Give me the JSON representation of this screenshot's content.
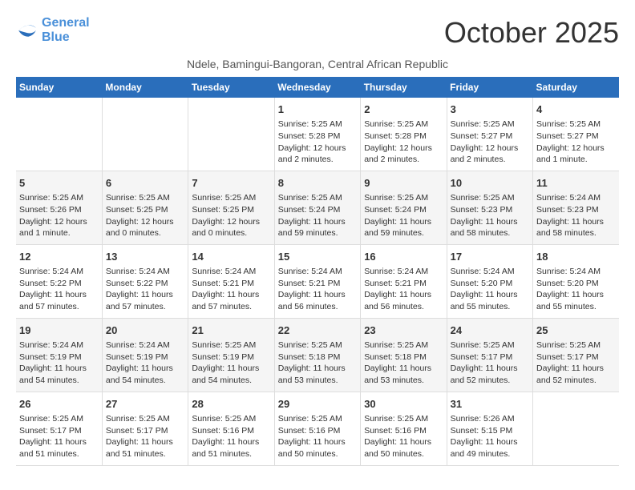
{
  "logo": {
    "line1": "General",
    "line2": "Blue"
  },
  "title": "October 2025",
  "subtitle": "Ndele, Bamingui-Bangoran, Central African Republic",
  "weekdays": [
    "Sunday",
    "Monday",
    "Tuesday",
    "Wednesday",
    "Thursday",
    "Friday",
    "Saturday"
  ],
  "weeks": [
    [
      {
        "day": "",
        "info": ""
      },
      {
        "day": "",
        "info": ""
      },
      {
        "day": "",
        "info": ""
      },
      {
        "day": "1",
        "info": "Sunrise: 5:25 AM\nSunset: 5:28 PM\nDaylight: 12 hours\nand 2 minutes."
      },
      {
        "day": "2",
        "info": "Sunrise: 5:25 AM\nSunset: 5:28 PM\nDaylight: 12 hours\nand 2 minutes."
      },
      {
        "day": "3",
        "info": "Sunrise: 5:25 AM\nSunset: 5:27 PM\nDaylight: 12 hours\nand 2 minutes."
      },
      {
        "day": "4",
        "info": "Sunrise: 5:25 AM\nSunset: 5:27 PM\nDaylight: 12 hours\nand 1 minute."
      }
    ],
    [
      {
        "day": "5",
        "info": "Sunrise: 5:25 AM\nSunset: 5:26 PM\nDaylight: 12 hours\nand 1 minute."
      },
      {
        "day": "6",
        "info": "Sunrise: 5:25 AM\nSunset: 5:25 PM\nDaylight: 12 hours\nand 0 minutes."
      },
      {
        "day": "7",
        "info": "Sunrise: 5:25 AM\nSunset: 5:25 PM\nDaylight: 12 hours\nand 0 minutes."
      },
      {
        "day": "8",
        "info": "Sunrise: 5:25 AM\nSunset: 5:24 PM\nDaylight: 11 hours\nand 59 minutes."
      },
      {
        "day": "9",
        "info": "Sunrise: 5:25 AM\nSunset: 5:24 PM\nDaylight: 11 hours\nand 59 minutes."
      },
      {
        "day": "10",
        "info": "Sunrise: 5:25 AM\nSunset: 5:23 PM\nDaylight: 11 hours\nand 58 minutes."
      },
      {
        "day": "11",
        "info": "Sunrise: 5:24 AM\nSunset: 5:23 PM\nDaylight: 11 hours\nand 58 minutes."
      }
    ],
    [
      {
        "day": "12",
        "info": "Sunrise: 5:24 AM\nSunset: 5:22 PM\nDaylight: 11 hours\nand 57 minutes."
      },
      {
        "day": "13",
        "info": "Sunrise: 5:24 AM\nSunset: 5:22 PM\nDaylight: 11 hours\nand 57 minutes."
      },
      {
        "day": "14",
        "info": "Sunrise: 5:24 AM\nSunset: 5:21 PM\nDaylight: 11 hours\nand 57 minutes."
      },
      {
        "day": "15",
        "info": "Sunrise: 5:24 AM\nSunset: 5:21 PM\nDaylight: 11 hours\nand 56 minutes."
      },
      {
        "day": "16",
        "info": "Sunrise: 5:24 AM\nSunset: 5:21 PM\nDaylight: 11 hours\nand 56 minutes."
      },
      {
        "day": "17",
        "info": "Sunrise: 5:24 AM\nSunset: 5:20 PM\nDaylight: 11 hours\nand 55 minutes."
      },
      {
        "day": "18",
        "info": "Sunrise: 5:24 AM\nSunset: 5:20 PM\nDaylight: 11 hours\nand 55 minutes."
      }
    ],
    [
      {
        "day": "19",
        "info": "Sunrise: 5:24 AM\nSunset: 5:19 PM\nDaylight: 11 hours\nand 54 minutes."
      },
      {
        "day": "20",
        "info": "Sunrise: 5:24 AM\nSunset: 5:19 PM\nDaylight: 11 hours\nand 54 minutes."
      },
      {
        "day": "21",
        "info": "Sunrise: 5:25 AM\nSunset: 5:19 PM\nDaylight: 11 hours\nand 54 minutes."
      },
      {
        "day": "22",
        "info": "Sunrise: 5:25 AM\nSunset: 5:18 PM\nDaylight: 11 hours\nand 53 minutes."
      },
      {
        "day": "23",
        "info": "Sunrise: 5:25 AM\nSunset: 5:18 PM\nDaylight: 11 hours\nand 53 minutes."
      },
      {
        "day": "24",
        "info": "Sunrise: 5:25 AM\nSunset: 5:17 PM\nDaylight: 11 hours\nand 52 minutes."
      },
      {
        "day": "25",
        "info": "Sunrise: 5:25 AM\nSunset: 5:17 PM\nDaylight: 11 hours\nand 52 minutes."
      }
    ],
    [
      {
        "day": "26",
        "info": "Sunrise: 5:25 AM\nSunset: 5:17 PM\nDaylight: 11 hours\nand 51 minutes."
      },
      {
        "day": "27",
        "info": "Sunrise: 5:25 AM\nSunset: 5:17 PM\nDaylight: 11 hours\nand 51 minutes."
      },
      {
        "day": "28",
        "info": "Sunrise: 5:25 AM\nSunset: 5:16 PM\nDaylight: 11 hours\nand 51 minutes."
      },
      {
        "day": "29",
        "info": "Sunrise: 5:25 AM\nSunset: 5:16 PM\nDaylight: 11 hours\nand 50 minutes."
      },
      {
        "day": "30",
        "info": "Sunrise: 5:25 AM\nSunset: 5:16 PM\nDaylight: 11 hours\nand 50 minutes."
      },
      {
        "day": "31",
        "info": "Sunrise: 5:26 AM\nSunset: 5:15 PM\nDaylight: 11 hours\nand 49 minutes."
      },
      {
        "day": "",
        "info": ""
      }
    ]
  ]
}
